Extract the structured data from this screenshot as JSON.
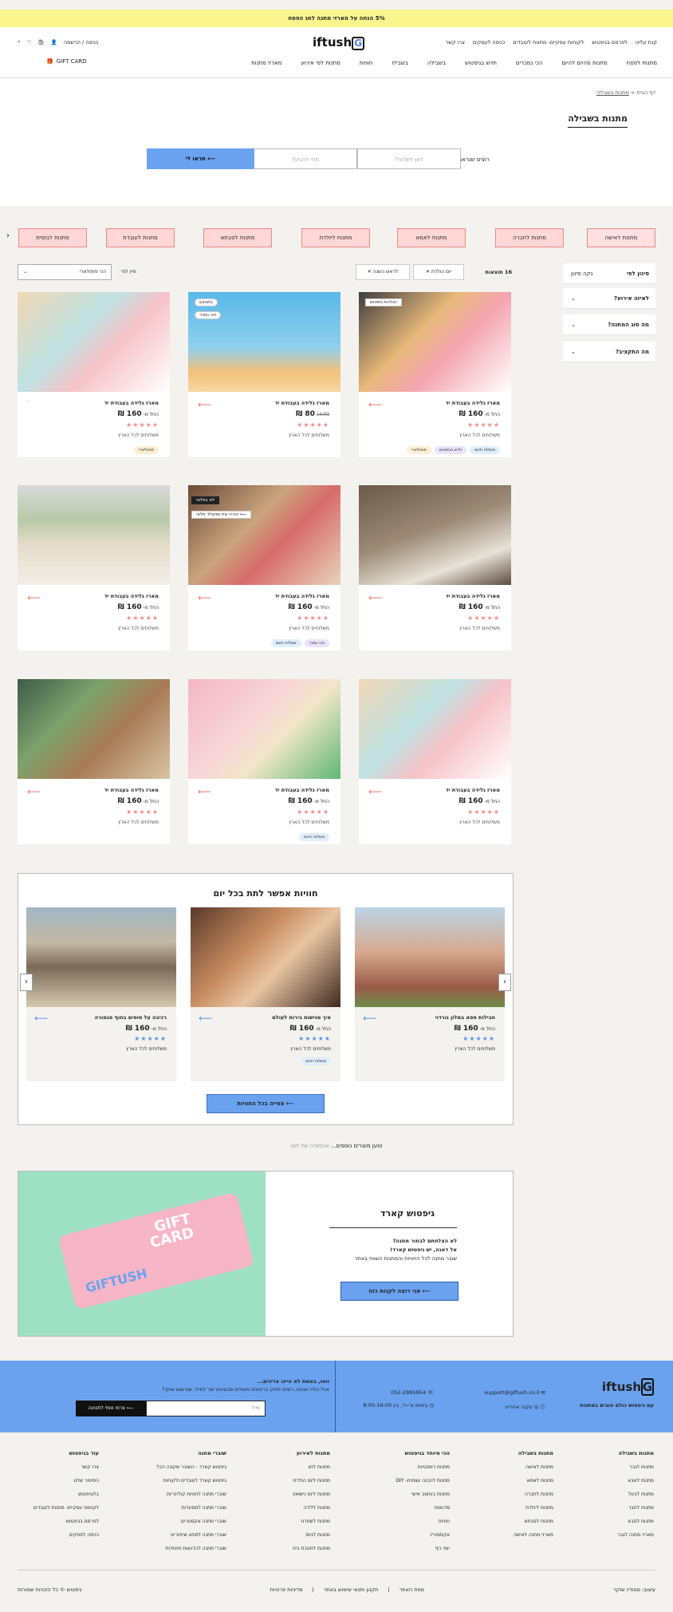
{
  "promo": "5% הנחה על מארזי מתנה לחג הפסח",
  "header": {
    "top_links": [
      "קנת עלינו",
      "לפרסם בגיפטוש",
      "לקוחות עסקיים- מתנות לעובדים",
      "כניסה לעסקים",
      "צרו קשר"
    ],
    "logo": "iftush",
    "logo_g": "G",
    "login": "כניסה / הרשמה",
    "nav": [
      "מתנות לפסח",
      "מתנות מהיום להיום",
      "הכי נמכרים",
      "חדש בגיפטוש",
      "בשבילה",
      "בשבילו",
      "חוויות",
      "מתנות לפי אירוע",
      "מארזי מתנות"
    ],
    "gift_card": "GIFT CARD"
  },
  "breadcrumb": {
    "home": "דף הבית",
    "sep": ">",
    "current": "מתנות בשבילה"
  },
  "page_title": "מתנות בשבילה",
  "finder": {
    "question": "רוצים שנראה לכם רק מתנות שיכולות להגיע אליכם בזמן?",
    "where_ph": "לאן לשלוח?",
    "when_ph": "מתי להגיע?",
    "button": "תראו לי"
  },
  "categories": [
    "מתנות לאישה",
    "מתנות לחברה",
    "מתנות לאמא",
    "מתנות ליולדת",
    "מתנות לסבתא",
    "מתנות לעובדת",
    "מתנות לבוסית"
  ],
  "filters": {
    "title": "סינון לפי",
    "clear": "נקה סינון",
    "groups": [
      "לאיזה אירוע?",
      "מה סוג המתנה?",
      "מה התקציב?"
    ],
    "count": "16 תוצאות",
    "chips": [
      "יום הולדת",
      "לראש השנה"
    ],
    "sort_label": "מיין לפי",
    "sort_value": "הכי פופולארי"
  },
  "products": [
    {
      "name": "מארז גלידה בעבודת יד",
      "price_prefix": "החל מ-",
      "price": "160 ₪",
      "stars": "★★★★★",
      "shipping": "משלוחים לכל הארץ",
      "tags": [
        "משלוח חינם",
        "חדש בגיפטוש",
        "פופולארי"
      ],
      "badge": "הנלהת גיפטוש"
    },
    {
      "name": "מארז גלידה בעבודת יד",
      "price_prefix": "",
      "price": "80 ₪",
      "old_price": "160₪",
      "stars": "★★★★★",
      "shipping": "משלוחים לכל הארץ",
      "tags": [],
      "badge": "במבצע",
      "badge2": "הכי נמכר"
    },
    {
      "name": "מארז גלידה בעבודת יד",
      "price_prefix": "החל מ-",
      "price": "160 ₪",
      "stars": "★★★★★",
      "shipping": "משלוחים לכל הארץ",
      "tags": [
        "פופולארי"
      ]
    },
    {
      "name": "מארז גלידה בעבודת יד",
      "price_prefix": "החל מ-",
      "price": "160 ₪",
      "stars": "★★★★★",
      "shipping": "משלוחים לכל הארץ",
      "tags": []
    },
    {
      "name": "מארז גלידה בעבודת יד",
      "price_prefix": "החל מ-",
      "price": "160 ₪",
      "stars": "★★★★★",
      "shipping": "משלוחים לכל הארץ",
      "tags": [
        "הכי נמכר",
        "משלוח חינם"
      ],
      "badge": "לא בפלאי",
      "overlay": "הכירו את שוקולד פלאי"
    },
    {
      "name": "מארז גלידה בעבודת יד",
      "price_prefix": "החל מ-",
      "price": "160 ₪",
      "stars": "★★★★★",
      "shipping": "משלוחים לכל הארץ",
      "tags": []
    },
    {
      "name": "מארז גלידה בעבודת יד",
      "price_prefix": "החל מ-",
      "price": "160 ₪",
      "stars": "★★★★★",
      "shipping": "משלוחים לכל הארץ",
      "tags": []
    },
    {
      "name": "מארז גלידה בעבודת יד",
      "price_prefix": "החל מ-",
      "price": "160 ₪",
      "stars": "★★★★★",
      "shipping": "משלוחים לכל הארץ",
      "tags": [
        "משלוח חינם"
      ]
    },
    {
      "name": "מארז גלידה בעבודת יד",
      "price_prefix": "החל מ-",
      "price": "160 ₪",
      "stars": "★★★★★",
      "shipping": "משלוחים לכל הארץ",
      "tags": []
    }
  ],
  "experiences": {
    "title": "חוויות אפשר לתת בכל יום",
    "items": [
      {
        "name": "חבילות ספא במלון נורדוי",
        "price_prefix": "החל מ-",
        "price": "160 ₪",
        "stars": "★★★★★",
        "shipping": "משלוחים לכל הארץ"
      },
      {
        "name": "איך מגישות בירות לעולם",
        "price_prefix": "החל מ-",
        "price": "160 ₪",
        "stars": "★★★★★",
        "shipping": "משלוחים לכל הארץ",
        "tag": "משלוח חינם"
      },
      {
        "name": "רכיבה על סוסים בחוף פנמורה",
        "price_prefix": "החל מ-",
        "price": "160 ₪",
        "stars": "★★★★★",
        "shipping": "משלוחים לכל הארץ"
      }
    ],
    "button": "צפייה בכל החוויות"
  },
  "load_more": {
    "text": "טוען מוצרים נוספים...",
    "hint": "אנימציה של לוגו"
  },
  "giftcard": {
    "title": "גיפטוש קארד",
    "line1": "לא הצלחתם לבחור מתנה?",
    "line2": "אל דאגה, יש גיפטוש קארד!",
    "line3": "שובר מתנה לכל החוויות והמתנות השוות באתר",
    "button": "אני רוצה לקנות כזה",
    "card_text1": "GIFT",
    "card_text2": "CARD",
    "card_text3": "GIFTUSH"
  },
  "footer": {
    "tagline": "עם גיפטוש כולם טובים במתנות",
    "email": "support@giftush.co.il",
    "phone": "052-2995954",
    "follow": "עקבו אחרינו",
    "hours": "בימים א'-ה', בין 8:00-16:00",
    "newsletter_title": "וואו, באמת לא היינו צריכים...",
    "newsletter_sub": "אבל כולה אנחנו, רוצים לפנק ברעיונות מעולים ומבצעים ישר למייל. שנרשום אותך?",
    "email_ph": "מייל",
    "newsletter_btn": "צרפו אותי לתנועה",
    "columns": [
      {
        "title": "מתנות בשבילה",
        "items": [
          "מתנות לגבר",
          "מתנות לאבא",
          "מתנות לבעל",
          "מתנות לחבר",
          "מתנות לסבא",
          "מארזי מתנה לגבר"
        ]
      },
      {
        "title": "מתנות בשבילה",
        "items": [
          "מתנות לאישה",
          "מתנות לאמא",
          "מתנות לחברה",
          "מתנות ליולדת",
          "מתנות לסבתא",
          "מארזי מתנה לאישה"
        ]
      },
      {
        "title": "הכי מיוחד בגיפטוש",
        "items": [
          "מתנות רומנטיות",
          "מתנות להכנה עצמית- DIY",
          "מתנות בעיצוב אישי",
          "סדנאות",
          "חוויות",
          "אקססוריז",
          "יומי כיף"
        ]
      },
      {
        "title": "מתנות לאירוע",
        "items": [
          "מתנות לחג",
          "מתנות ליום הולדת",
          "מתנות ליום נישואין",
          "מתנות ללידה",
          "מתנות לשחרור",
          "מתנות לגיוס",
          "מתנות לחנוכת בית"
        ]
      },
      {
        "title": "שוברי מתנה",
        "items": [
          "גיפטוש קארד - השובר שקונה הכל",
          "גיפטוש קארד לעובדים ולקוחות",
          "שוברי מתנה לחוויות קולינריות",
          "שוברי מתנה למסעדות",
          "שוברי מתנה אקסטרים",
          "שוברי מתנה לספא וציפורים",
          "שוברי מתנה להדנאות מיוחדות"
        ]
      },
      {
        "title": "עוד בגיפטוש",
        "items": [
          "צרו קשר",
          "הסיפור שלנו",
          "בלוגיפטוש",
          "לקוחות עסקיים- מתנות לעובדים",
          "לפרסם בגיפטוש",
          "כניסה לספקים"
        ]
      }
    ],
    "bottom": {
      "design": "עיצוב: סטודיו שוקר",
      "links": [
        "מפת האתר",
        "תקנון ותנאי שימוש באתר",
        "מדיניות פרטיות"
      ],
      "copyright": "גיפטוש © כל הזכויות שמורות"
    }
  }
}
